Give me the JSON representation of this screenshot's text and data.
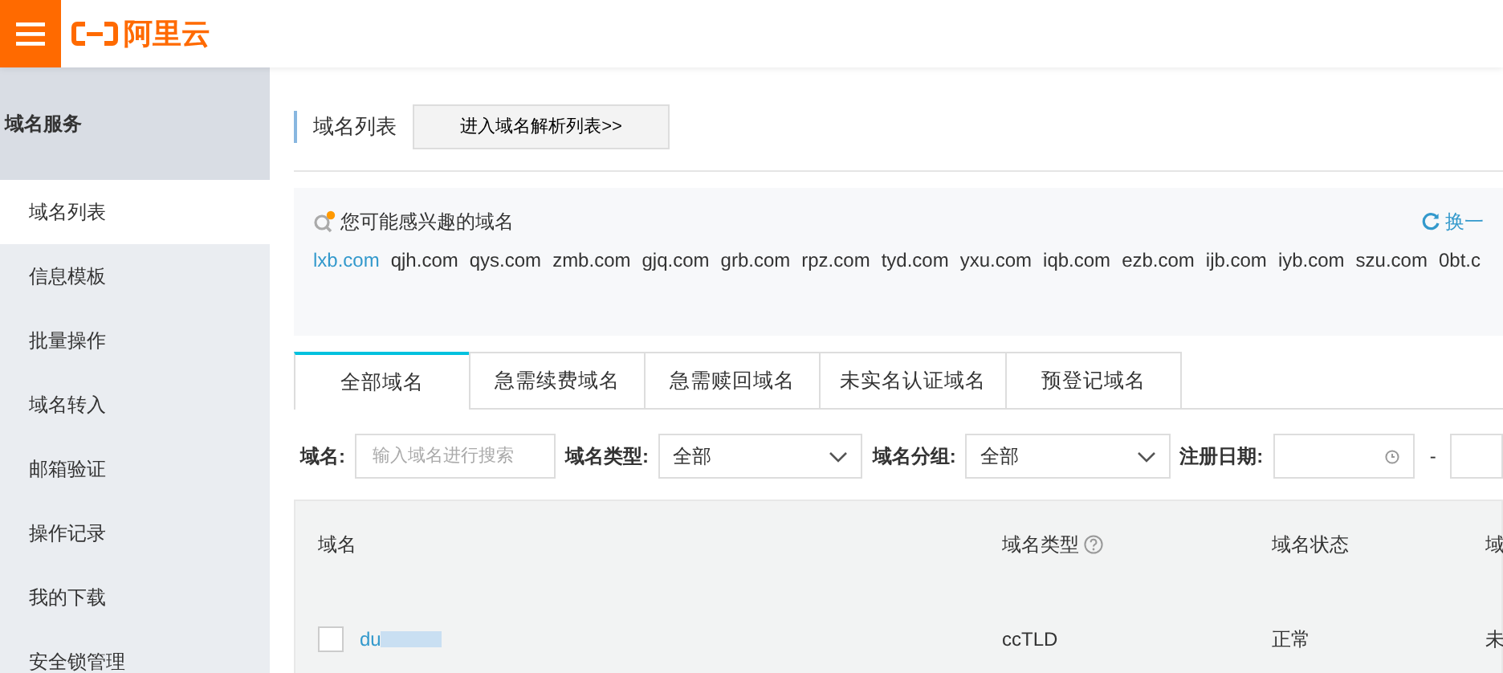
{
  "header": {
    "logo_text": "阿里云"
  },
  "sidebar": {
    "title": "域名服务",
    "items": [
      {
        "label": "域名列表",
        "selected": true
      },
      {
        "label": "信息模板",
        "selected": false
      },
      {
        "label": "批量操作",
        "selected": false
      },
      {
        "label": "域名转入",
        "selected": false
      },
      {
        "label": "邮箱验证",
        "selected": false
      },
      {
        "label": "操作记录",
        "selected": false
      },
      {
        "label": "我的下载",
        "selected": false
      },
      {
        "label": "安全锁管理",
        "selected": false
      }
    ]
  },
  "page_title": "域名列表",
  "resolve_button": "进入域名解析列表>>",
  "suggestions": {
    "title": "您可能感兴趣的域名",
    "refresh": "换一",
    "domains": [
      {
        "text": "lxb.com",
        "selected": true
      },
      {
        "text": "qjh.com",
        "selected": false
      },
      {
        "text": "qys.com",
        "selected": false
      },
      {
        "text": "zmb.com",
        "selected": false
      },
      {
        "text": "gjq.com",
        "selected": false
      },
      {
        "text": "grb.com",
        "selected": false
      },
      {
        "text": "rpz.com",
        "selected": false
      },
      {
        "text": "tyd.com",
        "selected": false
      },
      {
        "text": "yxu.com",
        "selected": false
      },
      {
        "text": "iqb.com",
        "selected": false
      },
      {
        "text": "ezb.com",
        "selected": false
      },
      {
        "text": "ijb.com",
        "selected": false
      },
      {
        "text": "iyb.com",
        "selected": false
      },
      {
        "text": "szu.com",
        "selected": false
      },
      {
        "text": "0bt.c",
        "selected": false
      }
    ]
  },
  "tabs": [
    {
      "label": "全部域名",
      "selected": true
    },
    {
      "label": "急需续费域名",
      "selected": false
    },
    {
      "label": "急需赎回域名",
      "selected": false
    },
    {
      "label": "未实名认证域名",
      "selected": false
    },
    {
      "label": "预登记域名",
      "selected": false
    }
  ],
  "filters": {
    "name_label": "域名:",
    "name_placeholder": "输入域名进行搜索",
    "type_label": "域名类型:",
    "type_value": "全部",
    "group_label": "域名分组:",
    "group_value": "全部",
    "date_label": "注册日期:",
    "date_separator": "-"
  },
  "table": {
    "columns": [
      "域名",
      "域名类型",
      "域名状态",
      "域"
    ],
    "rows": [
      {
        "checked": false,
        "cells": [
          "du",
          "ccTLD",
          "正常",
          "未"
        ]
      }
    ]
  }
}
